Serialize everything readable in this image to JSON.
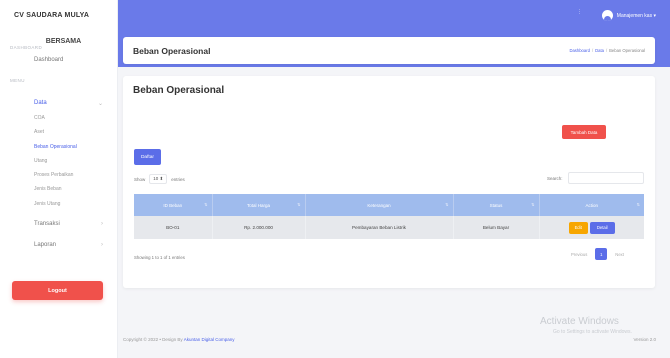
{
  "colors": {
    "accent": "#5b6de8",
    "header_band": "#6a7ae9",
    "danger": "#f0514b",
    "warning": "#f7a600",
    "table_header": "#9fbbed",
    "active_link": "#4a60e8"
  },
  "sidebar": {
    "brand": "CV SAUDARA MULYA",
    "brand_sub": "BERSAMA",
    "section_dashboard": "DASHBOARD",
    "dashboard_label": "Dashboard",
    "section_menu": "MENU",
    "data_label": "Data",
    "data_subitems": [
      {
        "label": "COA",
        "active": false
      },
      {
        "label": "Aset",
        "active": false
      },
      {
        "label": "Beban Operasional",
        "active": true
      },
      {
        "label": "Utang",
        "active": false
      },
      {
        "label": "Proses Perbaikan",
        "active": false
      },
      {
        "label": "Jenis Beban",
        "active": false
      },
      {
        "label": "Jenis Utang",
        "active": false
      }
    ],
    "transaksi_label": "Transaksi",
    "laporan_label": "Laporan",
    "logout_label": "Logout"
  },
  "topbar": {
    "dots": "⋮",
    "user_label": "Manajemen kas ▾"
  },
  "page_header": {
    "title": "Beban Operasional",
    "breadcrumb": [
      "Dashboard",
      "Data",
      "Beban Operasional"
    ]
  },
  "card": {
    "title": "Beban Operasional",
    "add_button": "Tambah Data",
    "list_button": "Daftar",
    "show_label": "Show",
    "show_value": "10 ⬍",
    "entries_label": "entries",
    "search_label": "Search:"
  },
  "table": {
    "columns": [
      "ID Beban",
      "Total Harga",
      "Keterangan",
      "Status",
      "Action"
    ],
    "rows": [
      {
        "id": "BO-01",
        "total": "Rp. 2.000.000",
        "keterangan": "Pembayaran Beban Listrik",
        "status": "Belum Bayar"
      }
    ],
    "edit_label": "Edit",
    "detail_label": "Detail"
  },
  "table_info": "Showing 1 to 1 of 1 entries",
  "pagination": {
    "previous": "Previous",
    "page": "1",
    "next": "Next"
  },
  "footer": {
    "copyright": "Copyright © 2022 • Design By",
    "company": "Akuntan Digital Company",
    "version": "Version 2.0"
  },
  "watermark": {
    "title": "Activate Windows",
    "subtitle": "Go to Settings to activate Windows."
  }
}
